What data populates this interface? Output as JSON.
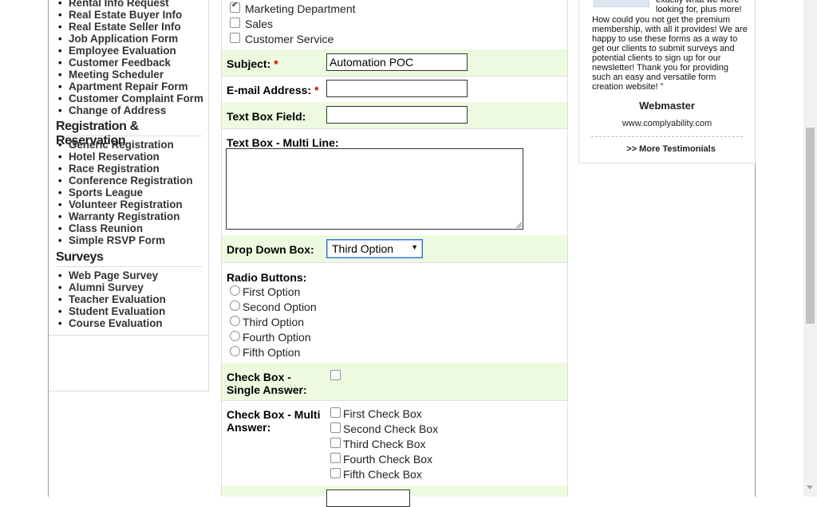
{
  "sidebar": {
    "section1_items": [
      "Rental Info Request",
      "Real Estate Buyer Info",
      "Real Estate Seller Info",
      "Job Application Form",
      "Employee Evaluation",
      "Customer Feedback",
      "Meeting Scheduler",
      "Apartment Repair Form",
      "Customer Complaint Form",
      "Change of Address"
    ],
    "heading_registration": "Registration & Reservation",
    "registration_items": [
      "Generic Registration",
      "Hotel Reservation",
      "Race Registration",
      "Conference Registration",
      "Sports League",
      "Volunteer Registration",
      "Warranty Registration",
      "Class Reunion",
      "Simple RSVP Form"
    ],
    "heading_surveys": "Surveys",
    "survey_items": [
      "Web Page Survey",
      "Alumni Survey",
      "Teacher Evaluation",
      "Student Evaluation",
      "Course Evaluation"
    ]
  },
  "form": {
    "department_options": [
      {
        "label": "Marketing Department",
        "checked": true
      },
      {
        "label": "Sales",
        "checked": false
      },
      {
        "label": "Customer Service",
        "checked": false
      }
    ],
    "subject_label": "Subject:",
    "subject_value": "Automation POC",
    "required_mark": "*",
    "email_label": "E-mail Address:",
    "email_value": "",
    "textbox_label": "Text Box Field:",
    "textbox_value": "",
    "multiline_label": "Text Box - Multi Line:",
    "dropdown_label": "Drop Down Box:",
    "dropdown_value": "Third Option",
    "radio_label": "Radio Buttons:",
    "radio_options": [
      "First Option",
      "Second Option",
      "Third Option",
      "Fourth Option",
      "Fifth Option"
    ],
    "check_single_label_1": "Check Box -",
    "check_single_label_2": "Single Answer:",
    "check_multi_label_1": "Check Box - Multi",
    "check_multi_label_2": "Answer:",
    "check_multi_options": [
      "First Check Box",
      "Second Check Box",
      "Third Check Box",
      "Fourth Check Box",
      "Fifth Check Box"
    ]
  },
  "testimonial": {
    "text_top": "exactly what we were looking for, plus more!",
    "text": "How could you not get the premium membership, with all it provides! We are happy to use these forms as a way to get our clients to submit surveys and potential clients to sign up for our newsletter! Thank you for providing such an easy and versatile form creation website! \"",
    "author": "Webmaster",
    "url": "www.complyability.com",
    "more_link": ">> More Testimonials"
  }
}
